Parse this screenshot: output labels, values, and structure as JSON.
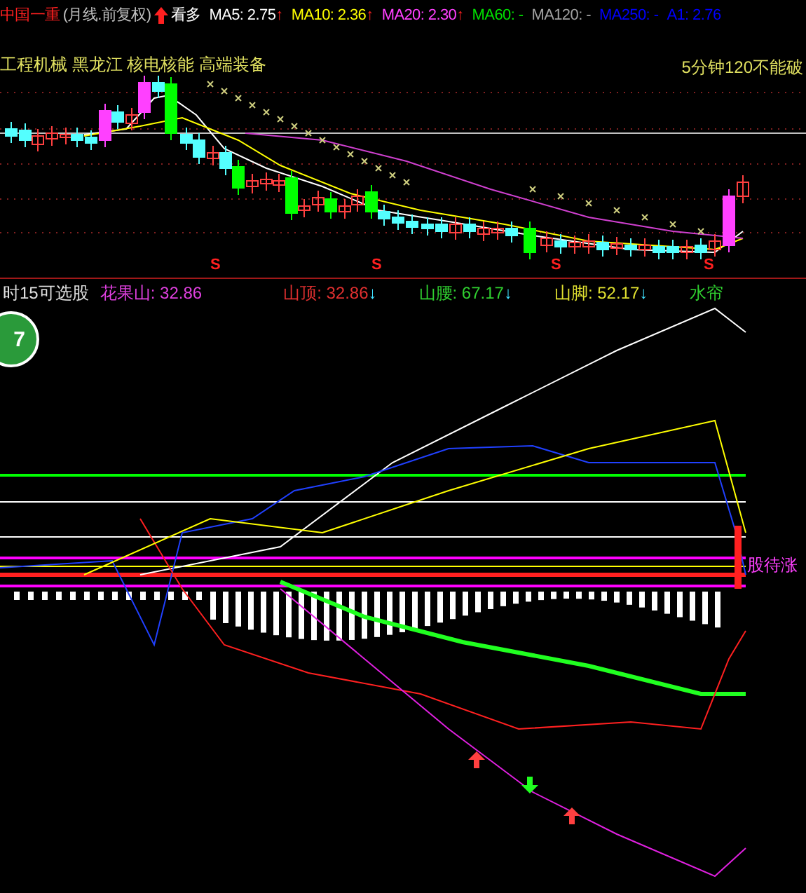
{
  "header": {
    "title": "中国一重",
    "period": "(月线.前复权)",
    "signal": "看多",
    "averages": [
      {
        "label": "MA5: 2.75",
        "arrow": "↑",
        "color": "#ffffff"
      },
      {
        "label": "MA10: 2.36",
        "arrow": "↑",
        "color": "#ffff00"
      },
      {
        "label": "MA20: 2.30",
        "arrow": "↑",
        "color": "#ff40ff"
      },
      {
        "label": "MA60: -",
        "color": "#00e000"
      },
      {
        "label": "MA120: -",
        "color": "#a0a0a0"
      },
      {
        "label": "MA250: -",
        "color": "#0000ff"
      },
      {
        "label": "A1: 2.76",
        "color": "#0000ff"
      }
    ]
  },
  "tags": "工程机械 黑龙江 核电核能 高端装备",
  "note": "5分钟120不能破",
  "sell_marks": [
    "S",
    "S",
    "S",
    "S"
  ],
  "indicator": {
    "prefix": "时15可选股",
    "values": [
      {
        "label": "花果山: 32.86",
        "color": "#e040e0"
      },
      {
        "label": "山顶: 32.86",
        "arrow": "↓",
        "color": "#e03030"
      },
      {
        "label": "山腰: 67.17",
        "arrow": "↓",
        "color": "#30d030"
      },
      {
        "label": "山脚: 52.17",
        "arrow": "↓",
        "color": "#e0e030"
      },
      {
        "label": "水帘",
        "color": "#30d030"
      }
    ]
  },
  "badge": "7",
  "side_label": "股待涨"
}
